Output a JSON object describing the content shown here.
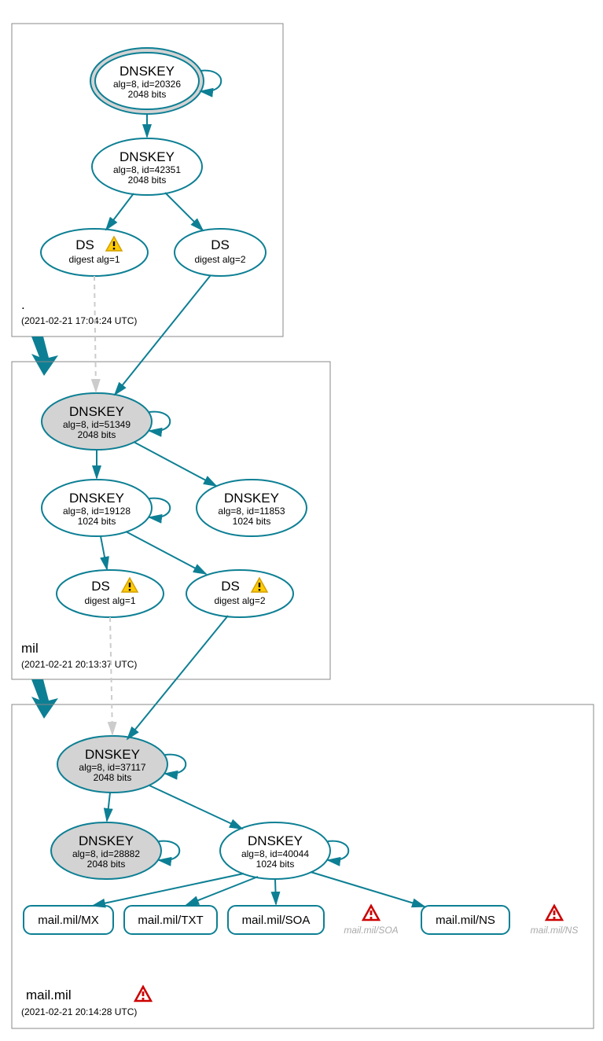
{
  "zones": {
    "root": {
      "label": ".",
      "time": "(2021-02-21 17:04:24 UTC)"
    },
    "mil": {
      "label": "mil",
      "time": "(2021-02-21 20:13:37 UTC)"
    },
    "mailmil": {
      "label": "mail.mil",
      "time": "(2021-02-21 20:14:28 UTC)"
    }
  },
  "nodes": {
    "root_ksk": {
      "title": "DNSKEY",
      "sub1": "alg=8, id=20326",
      "sub2": "2048 bits"
    },
    "root_zsk": {
      "title": "DNSKEY",
      "sub1": "alg=8, id=42351",
      "sub2": "2048 bits"
    },
    "root_ds1": {
      "title": "DS",
      "sub1": "digest alg=1"
    },
    "root_ds2": {
      "title": "DS",
      "sub1": "digest alg=2"
    },
    "mil_ksk": {
      "title": "DNSKEY",
      "sub1": "alg=8, id=51349",
      "sub2": "2048 bits"
    },
    "mil_zsk1": {
      "title": "DNSKEY",
      "sub1": "alg=8, id=19128",
      "sub2": "1024 bits"
    },
    "mil_zsk2": {
      "title": "DNSKEY",
      "sub1": "alg=8, id=11853",
      "sub2": "1024 bits"
    },
    "mil_ds1": {
      "title": "DS",
      "sub1": "digest alg=1"
    },
    "mil_ds2": {
      "title": "DS",
      "sub1": "digest alg=2"
    },
    "mm_ksk": {
      "title": "DNSKEY",
      "sub1": "alg=8, id=37117",
      "sub2": "2048 bits"
    },
    "mm_k2": {
      "title": "DNSKEY",
      "sub1": "alg=8, id=28882",
      "sub2": "2048 bits"
    },
    "mm_zsk": {
      "title": "DNSKEY",
      "sub1": "alg=8, id=40044",
      "sub2": "1024 bits"
    },
    "mx": {
      "label": "mail.mil/MX"
    },
    "txt": {
      "label": "mail.mil/TXT"
    },
    "soa": {
      "label": "mail.mil/SOA"
    },
    "ns": {
      "label": "mail.mil/NS"
    },
    "soa_err": {
      "label": "mail.mil/SOA"
    },
    "ns_err": {
      "label": "mail.mil/NS"
    }
  }
}
